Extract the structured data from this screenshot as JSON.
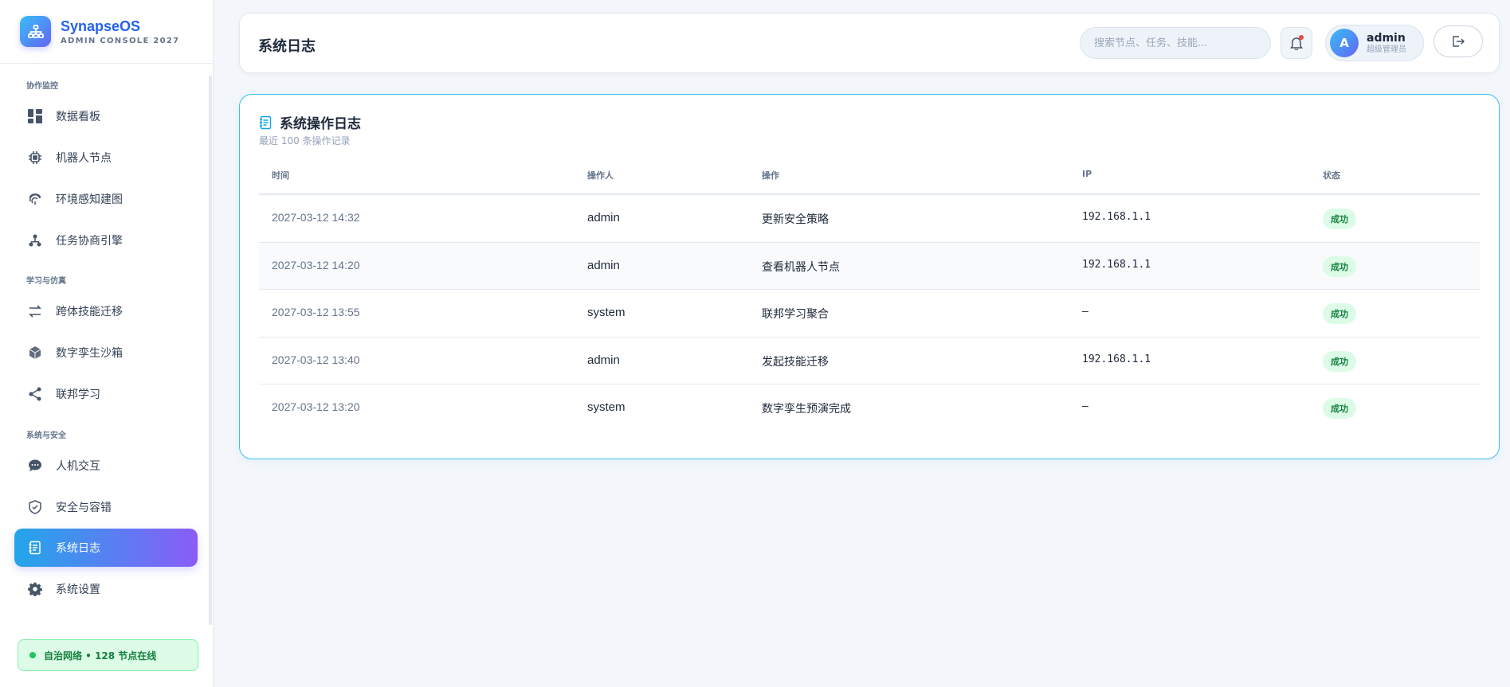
{
  "brand": {
    "name": "SynapseOS",
    "sub": "ADMIN CONSOLE 2027"
  },
  "sidebar": {
    "groups": [
      "协作监控",
      "学习与仿真",
      "系统与安全"
    ],
    "items": [
      {
        "label": "数据看板",
        "icon": "dashboard-icon"
      },
      {
        "label": "机器人节点",
        "icon": "chip-icon"
      },
      {
        "label": "环境感知建图",
        "icon": "fingerprint-icon"
      },
      {
        "label": "任务协商引擎",
        "icon": "hierarchy-icon"
      },
      {
        "label": "跨体技能迁移",
        "icon": "transfer-arrows-icon"
      },
      {
        "label": "数字孪生沙箱",
        "icon": "cube-icon"
      },
      {
        "label": "联邦学习",
        "icon": "share-nodes-icon"
      },
      {
        "label": "人机交互",
        "icon": "chat-bubble-icon"
      },
      {
        "label": "安全与容错",
        "icon": "shield-check-icon"
      },
      {
        "label": "系统日志",
        "icon": "log-document-icon",
        "active": true
      },
      {
        "label": "系统设置",
        "icon": "gear-icon"
      }
    ],
    "network_status": "自治网络 • 128 节点在线"
  },
  "header": {
    "title": "系统日志",
    "search_placeholder": "搜索节点、任务、技能...",
    "user": {
      "initial": "A",
      "name": "admin",
      "role": "超级管理员"
    }
  },
  "card": {
    "title": "系统操作日志",
    "subtitle": "最近 100 条操作记录",
    "columns": [
      "时间",
      "操作人",
      "操作",
      "IP",
      "状态"
    ],
    "rows": [
      {
        "time": "2027-03-12 14:32",
        "operator": "admin",
        "action": "更新安全策略",
        "ip": "192.168.1.1",
        "status": "成功"
      },
      {
        "time": "2027-03-12 14:20",
        "operator": "admin",
        "action": "查看机器人节点",
        "ip": "192.168.1.1",
        "status": "成功"
      },
      {
        "time": "2027-03-12 13:55",
        "operator": "system",
        "action": "联邦学习聚合",
        "ip": "—",
        "status": "成功"
      },
      {
        "time": "2027-03-12 13:40",
        "operator": "admin",
        "action": "发起技能迁移",
        "ip": "192.168.1.1",
        "status": "成功"
      },
      {
        "time": "2027-03-12 13:20",
        "operator": "system",
        "action": "数字孪生预演完成",
        "ip": "—",
        "status": "成功"
      }
    ]
  },
  "colors": {
    "accent": "#2563eb",
    "active_start": "#22a6ea",
    "active_end": "#8b5cf6",
    "success": "#15803d"
  }
}
